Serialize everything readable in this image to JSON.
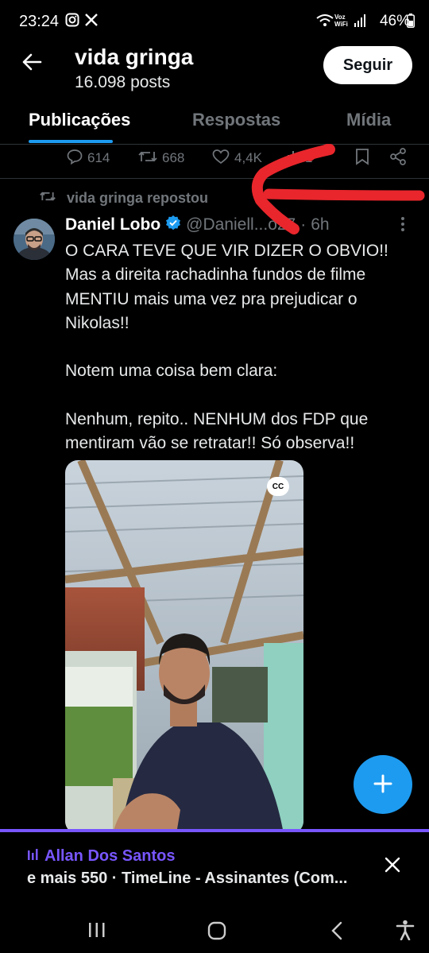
{
  "status_bar": {
    "time": "23:24",
    "notification_icons": [
      "instagram-icon",
      "x-logo-icon"
    ],
    "signal_text": "Voz WiFi",
    "battery": "46%"
  },
  "header": {
    "title": "vida gringa",
    "posts_count": "16.098 posts",
    "follow_label": "Seguir"
  },
  "tabs": [
    {
      "label": "Publicações",
      "active": true
    },
    {
      "label": "Respostas",
      "active": false
    },
    {
      "label": "Mídia",
      "active": false
    }
  ],
  "previous_tweet_actions": {
    "replies": "614",
    "reposts": "668",
    "likes": "4,4K",
    "views": "1"
  },
  "repost_label": "vida gringa repostou",
  "tweet": {
    "author_name": "Daniel Lobo",
    "author_handle": "@Daniell...o27",
    "separator": "·",
    "time": "6h",
    "text": "O CARA TEVE QUE VIR DIZER O OBVIO!!\nMas a direita rachadinha fundos de filme MENTIU mais uma vez pra prejudicar o Nikolas!!\n\nNotem uma coisa bem clara:\n\nNenhum, repito.. NENHUM dos FDP que mentiram vão se retratar!! Só observa!!",
    "media_badge": "CC"
  },
  "space_bar": {
    "host": "Allan Dos Santos",
    "description": "e mais 550 · TimeLine - Assinantes (Com..."
  },
  "colors": {
    "accent": "#1d9bf0",
    "spaces": "#7856ff",
    "annotation": "#e8262c"
  }
}
